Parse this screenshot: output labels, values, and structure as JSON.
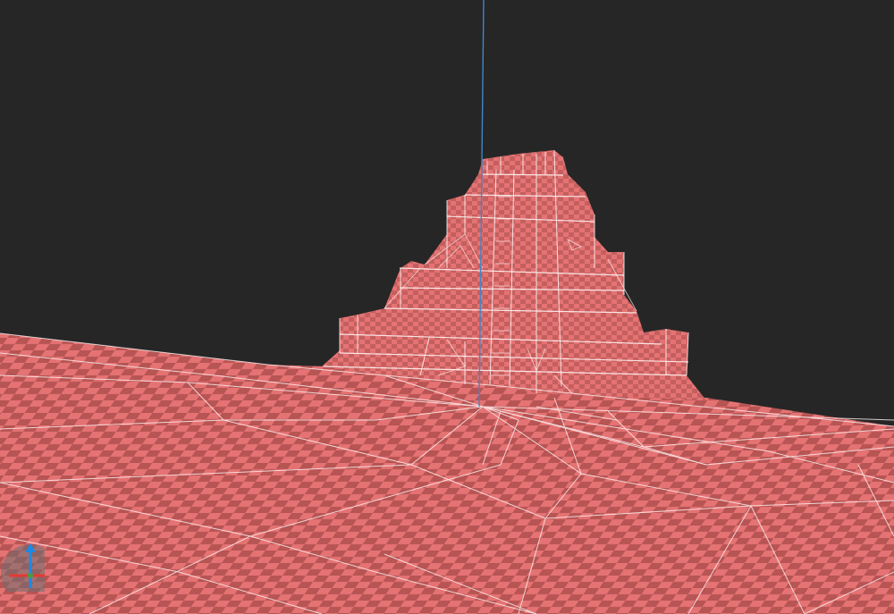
{
  "viewport": {
    "background_color": "#262626",
    "mesh_color": "#e57373",
    "checker_dark_color": "#b75454",
    "wire_color": "#fff3f3",
    "axis_line_color": "#3f86c9",
    "render_mode": "checker-wireframe"
  },
  "gizmo": {
    "up_axis_color": "#1e88e5",
    "right_axis_color": "#e53935",
    "forward_axis_color": "#43a047",
    "icon": "axis-gizmo-icon"
  }
}
